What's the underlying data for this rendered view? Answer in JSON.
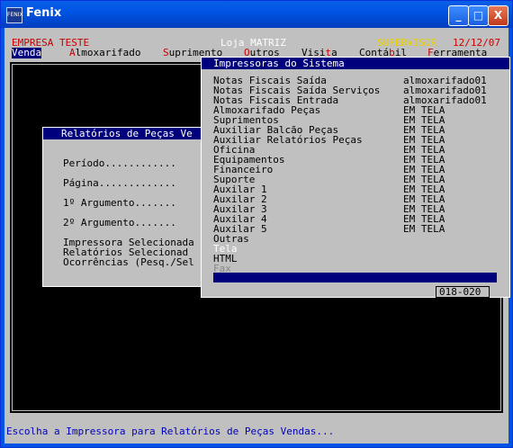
{
  "window": {
    "title": "Fenix",
    "icon": "app-icon",
    "icon_text": "FENIX",
    "buttons": {
      "minimize": "_",
      "maximize": "□",
      "close": "X"
    }
  },
  "header": {
    "company": "EMPRESA TESTE",
    "store": "Loja MATRIZ",
    "role": "SUPERVISOR",
    "date": "12/12/07"
  },
  "menu": {
    "items": [
      {
        "pre": "",
        "hk": "V",
        "rest": "enda",
        "active": true
      },
      {
        "pre": "",
        "hk": "A",
        "rest": "lmoxarifado",
        "active": false
      },
      {
        "pre": "",
        "hk": "S",
        "rest": "uprimento",
        "active": false
      },
      {
        "pre": "",
        "hk": "O",
        "rest": "utros",
        "active": false
      },
      {
        "pre": "Visi",
        "hk": "t",
        "rest": "a",
        "active": false
      },
      {
        "pre": "Contá",
        "hk": "b",
        "rest": "il",
        "active": false
      },
      {
        "pre": "",
        "hk": "F",
        "rest": "erramenta",
        "active": false
      }
    ]
  },
  "report_dialog": {
    "title": "Relatórios de Peças Ve",
    "fields": [
      "Período............",
      "Página.............",
      "1º Argumento.......",
      "2º Argumento.......",
      "Impressora Selecionada",
      "Relatórios Selecionad",
      "Ocorrências (Pesq./Sel"
    ]
  },
  "printer_dialog": {
    "title": "Impressoras do Sistema",
    "items": [
      {
        "name": "Notas Fiscais Saída",
        "value": "almoxarifado01"
      },
      {
        "name": "Notas Fiscais Saída Serviços",
        "value": "almoxarifado01"
      },
      {
        "name": "Notas Fiscais Entrada",
        "value": "almoxarifado01"
      },
      {
        "name": "Almoxarifado Peças",
        "value": "EM TELA"
      },
      {
        "name": "Suprimentos",
        "value": "EM TELA"
      },
      {
        "name": "Auxiliar Balcão Peças",
        "value": "EM TELA"
      },
      {
        "name": "Auxiliar Relatórios Peças",
        "value": "EM TELA"
      },
      {
        "name": "Oficina",
        "value": "EM TELA"
      },
      {
        "name": "Equipamentos",
        "value": "EM TELA"
      },
      {
        "name": "Financeiro",
        "value": "EM TELA"
      },
      {
        "name": "Suporte",
        "value": "EM TELA"
      },
      {
        "name": "Auxilar 1",
        "value": "EM TELA"
      },
      {
        "name": "Auxilar 2",
        "value": "EM TELA"
      },
      {
        "name": "Auxilar 3",
        "value": "EM TELA"
      },
      {
        "name": "Auxilar 4",
        "value": "EM TELA"
      },
      {
        "name": "Auxilar 5",
        "value": "EM TELA"
      },
      {
        "name": "Outras",
        "value": ""
      },
      {
        "name": "Tela",
        "value": "",
        "selected": true
      },
      {
        "name": "HTML",
        "value": ""
      },
      {
        "name": "Fax",
        "value": "",
        "disabled": true
      }
    ],
    "pager": "018-020"
  },
  "status": {
    "message": "Escolha a Impressora para Relatórios de Peças Vendas..."
  },
  "colors": {
    "titlebar": "#0054e3",
    "menu_active": "#00007c",
    "hotkey": "#c80000",
    "status_text": "#0000c0"
  }
}
